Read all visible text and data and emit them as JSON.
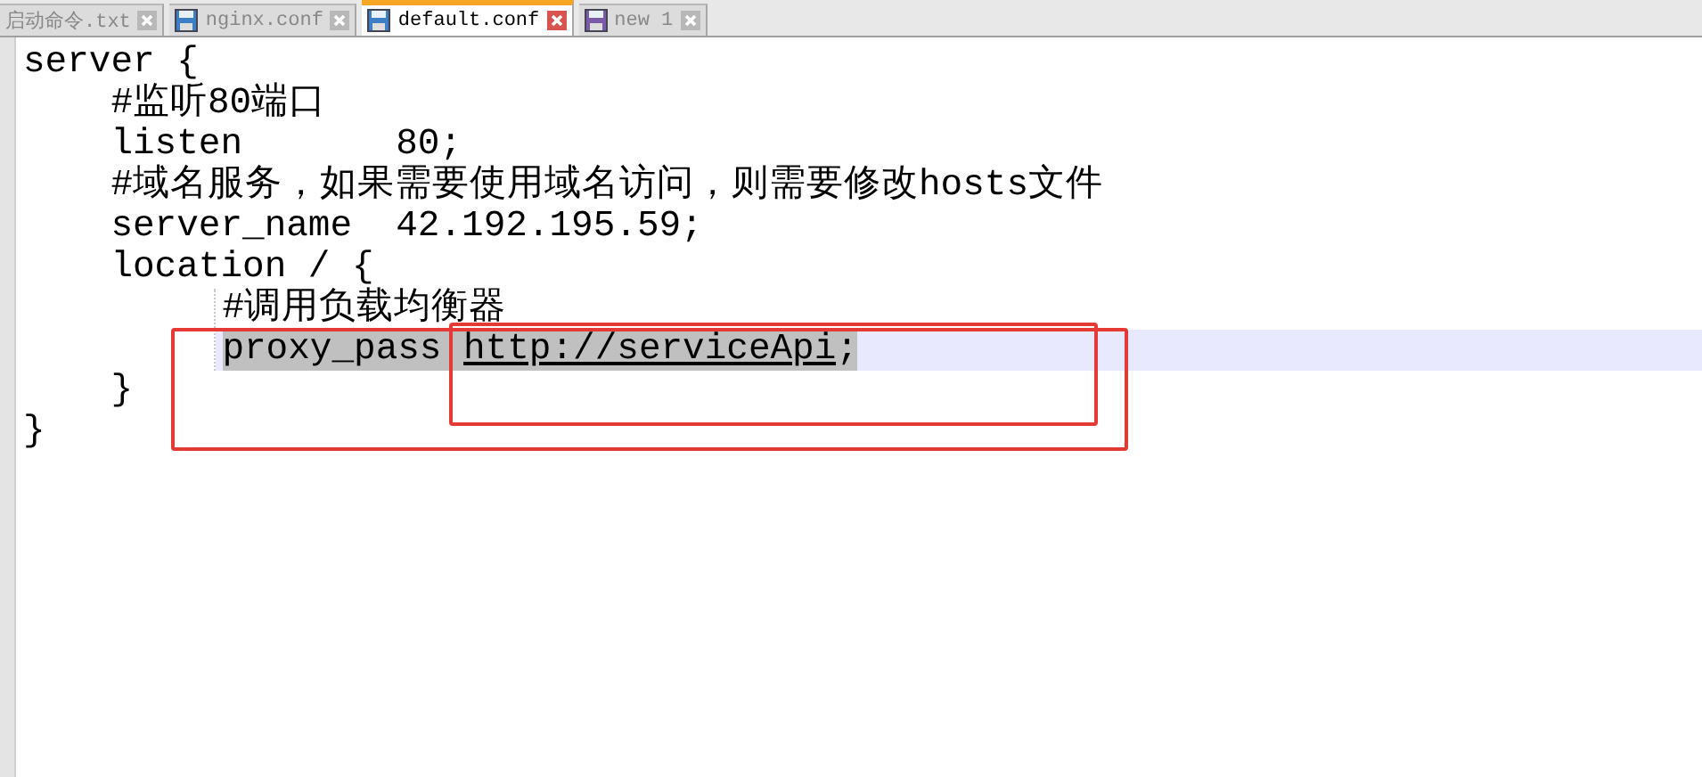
{
  "tabs": [
    {
      "label": "启动命令.txt",
      "selected": false
    },
    {
      "label": "nginx.conf",
      "selected": false,
      "kind": "saved"
    },
    {
      "label": "default.conf",
      "selected": true,
      "kind": "saved"
    },
    {
      "label": "new 1",
      "selected": false,
      "kind": "new"
    }
  ],
  "editor": {
    "lines": [
      {
        "segments": [
          {
            "text": "server {"
          }
        ],
        "children": [
          {
            "segments": [
              {
                "text": "#监听80端口"
              }
            ]
          },
          {
            "segments": [
              {
                "text": "listen       80;"
              }
            ]
          },
          {
            "segments": [
              {
                "text": "#域名服务，如果需要使用域名访问，则需要修改hosts文件"
              }
            ]
          },
          {
            "segments": [
              {
                "text": "server_name  42.192.195.59;"
              }
            ]
          },
          {
            "segments": [
              {
                "text": "location / {"
              }
            ],
            "children": [
              {
                "segments": [
                  {
                    "text": "#调用负载均衡器"
                  }
                ]
              },
              {
                "segments": [
                  {
                    "text": "proxy_pass "
                  },
                  {
                    "text": "http://serviceApi",
                    "kind": "link"
                  },
                  {
                    "text": ";"
                  }
                ],
                "current": true,
                "selected": true
              }
            ]
          },
          {
            "segments": [
              {
                "text": "}"
              }
            ]
          }
        ]
      },
      {
        "segments": [
          {
            "text": "}"
          }
        ]
      }
    ]
  },
  "annotations": [
    {
      "kind": "rectangle",
      "color": "#e53935"
    },
    {
      "kind": "rectangle",
      "color": "#e53935"
    }
  ]
}
